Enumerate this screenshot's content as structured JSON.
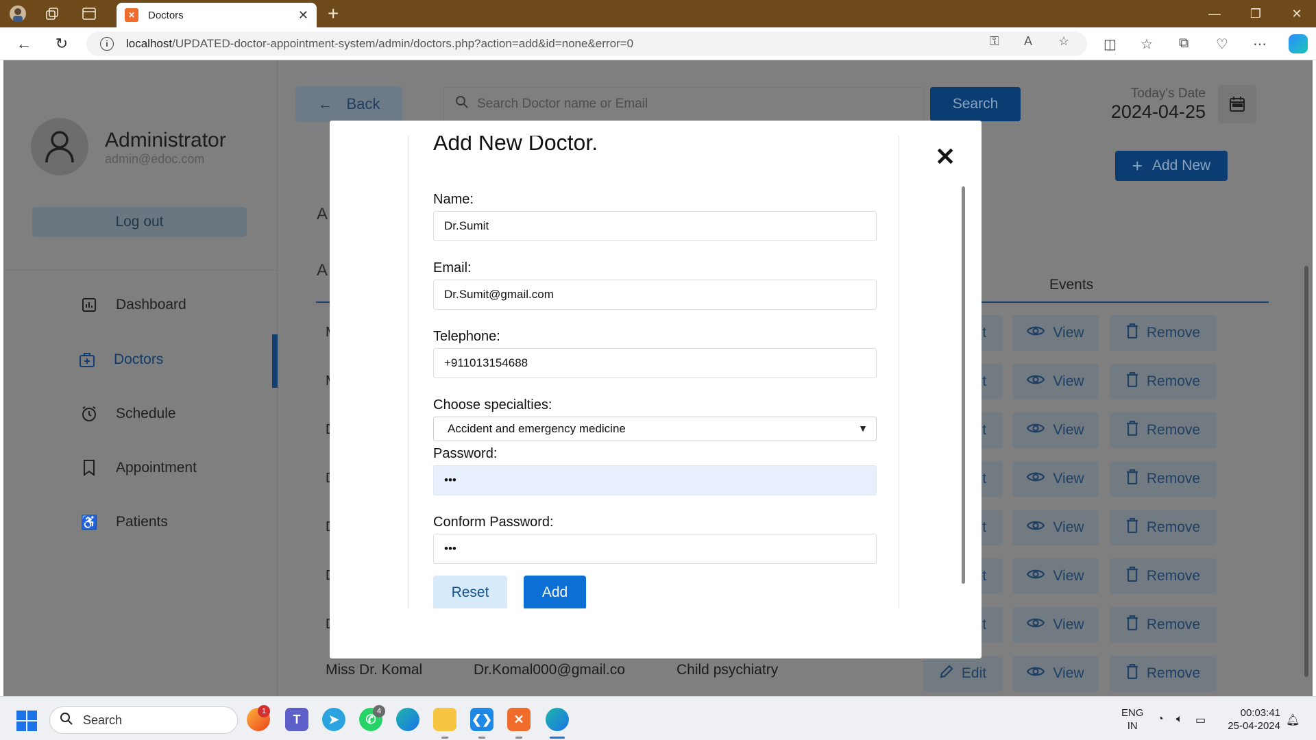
{
  "browser": {
    "tab_title": "Doctors",
    "tab_favicon": "xampp-icon",
    "url_host": "localhost",
    "url_path": "/UPDATED-doctor-appointment-system/admin/doctors.php?action=add&id=none&error=0"
  },
  "sidebar": {
    "admin_name": "Administrator",
    "admin_email": "admin@edoc.com",
    "logout_label": "Log out",
    "items": [
      {
        "label": "Dashboard",
        "icon": "dashboard-icon"
      },
      {
        "label": "Doctors",
        "icon": "doctors-icon",
        "active": true
      },
      {
        "label": "Schedule",
        "icon": "clock-icon"
      },
      {
        "label": "Appointment",
        "icon": "bookmark-icon"
      },
      {
        "label": "Patients",
        "icon": "wheelchair-icon"
      }
    ]
  },
  "header": {
    "back_label": "Back",
    "search_placeholder": "Search Doctor name or Email",
    "search_label": "Search",
    "date_label": "Today's Date",
    "date_value": "2024-04-25",
    "add_new_label": "Add New"
  },
  "table": {
    "events_header": "Events",
    "edit_label": "Edit",
    "view_label": "View",
    "remove_label": "Remove",
    "last_row": {
      "name": "Miss Dr. Komal",
      "email": "Dr.Komal000@gmail.co",
      "specialty": "Child psychiatry"
    }
  },
  "modal": {
    "title": "Add New Doctor.",
    "name_label": "Name:",
    "name_value": "Dr.Sumit",
    "email_label": "Email:",
    "email_value": "Dr.Sumit@gmail.com",
    "tel_label": "Telephone:",
    "tel_value": "+911013154688",
    "specialty_label": "Choose specialties:",
    "specialty_value": "Accident and emergency medicine",
    "password_label": "Password:",
    "password_value": "•••",
    "confirm_label": "Conform Password:",
    "confirm_value": "•••",
    "reset_label": "Reset",
    "add_label": "Add"
  },
  "taskbar": {
    "search_label": "Search",
    "firefox_badge": "1",
    "whatsapp_badge": "4",
    "lang_line1": "ENG",
    "lang_line2": "IN",
    "time": "00:03:41",
    "date": "25-04-2024"
  },
  "colors": {
    "title_bar": "#6e4a1a",
    "primary": "#0b6fd6",
    "overlay": "#7f7f7f"
  }
}
